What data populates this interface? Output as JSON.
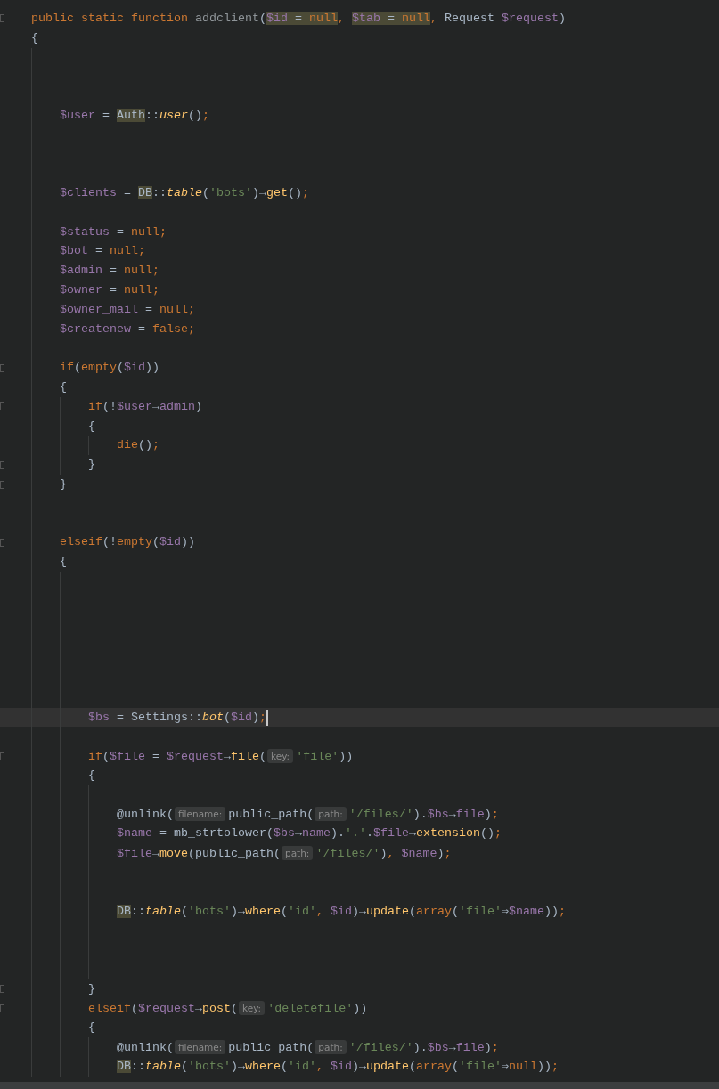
{
  "editor": {
    "lines": [
      {
        "fold_marker": true,
        "current": false,
        "tokens": [
          {
            "text": "public static function ",
            "kind": "kw"
          },
          {
            "text": "addclient",
            "kind": "decl"
          },
          {
            "text": "(",
            "kind": "plain"
          },
          {
            "text": "$id",
            "kind": "var_hl"
          },
          {
            "text": " = ",
            "kind": "plain_hl"
          },
          {
            "text": "null",
            "kind": "kw_hl"
          },
          {
            "text": ", ",
            "kind": "kw"
          },
          {
            "text": "$tab",
            "kind": "var_hl"
          },
          {
            "text": " = ",
            "kind": "plain_hl"
          },
          {
            "text": "null",
            "kind": "kw_hl"
          },
          {
            "text": ", ",
            "kind": "kw"
          },
          {
            "text": "Request ",
            "kind": "plain"
          },
          {
            "text": "$request",
            "kind": "var"
          },
          {
            "text": ")",
            "kind": "plain"
          }
        ]
      },
      {
        "fold_marker": false,
        "current": false,
        "tokens": [
          {
            "text": "{",
            "kind": "plain"
          }
        ],
        "children": [
          {
            "fold_marker": false,
            "current": false
          },
          {
            "fold_marker": false,
            "current": false
          },
          {
            "fold_marker": false,
            "current": false
          },
          {
            "fold_marker": false,
            "current": false,
            "tokens": [
              {
                "text": "$user",
                "kind": "var"
              },
              {
                "text": " = ",
                "kind": "plain"
              },
              {
                "text": "Auth",
                "kind": "class_hl"
              },
              {
                "text": "::",
                "kind": "plain"
              },
              {
                "text": "user",
                "kind": "call"
              },
              {
                "text": "()",
                "kind": "plain"
              },
              {
                "text": ";",
                "kind": "kw"
              }
            ]
          },
          {
            "fold_marker": false,
            "current": false
          },
          {
            "fold_marker": false,
            "current": false
          },
          {
            "fold_marker": false,
            "current": false
          },
          {
            "fold_marker": false,
            "current": false,
            "tokens": [
              {
                "text": "$clients",
                "kind": "var"
              },
              {
                "text": " = ",
                "kind": "plain"
              },
              {
                "text": "DB",
                "kind": "class_hl"
              },
              {
                "text": "::",
                "kind": "plain"
              },
              {
                "text": "table",
                "kind": "call"
              },
              {
                "text": "(",
                "kind": "plain"
              },
              {
                "text": "'bots'",
                "kind": "str"
              },
              {
                "text": ")→",
                "kind": "plain"
              },
              {
                "text": "get",
                "kind": "fn"
              },
              {
                "text": "()",
                "kind": "plain"
              },
              {
                "text": ";",
                "kind": "kw"
              }
            ]
          },
          {
            "fold_marker": false,
            "current": false
          },
          {
            "fold_marker": false,
            "current": false,
            "tokens": [
              {
                "text": "$status",
                "kind": "var"
              },
              {
                "text": " = ",
                "kind": "plain"
              },
              {
                "text": "null;",
                "kind": "kw"
              }
            ]
          },
          {
            "fold_marker": false,
            "current": false,
            "tokens": [
              {
                "text": "$bot",
                "kind": "var"
              },
              {
                "text": " = ",
                "kind": "plain"
              },
              {
                "text": "null;",
                "kind": "kw"
              }
            ]
          },
          {
            "fold_marker": false,
            "current": false,
            "tokens": [
              {
                "text": "$admin",
                "kind": "var"
              },
              {
                "text": " = ",
                "kind": "plain"
              },
              {
                "text": "null;",
                "kind": "kw"
              }
            ]
          },
          {
            "fold_marker": false,
            "current": false,
            "tokens": [
              {
                "text": "$owner",
                "kind": "var"
              },
              {
                "text": " = ",
                "kind": "plain"
              },
              {
                "text": "null;",
                "kind": "kw"
              }
            ]
          },
          {
            "fold_marker": false,
            "current": false,
            "tokens": [
              {
                "text": "$owner_mail",
                "kind": "var"
              },
              {
                "text": " = ",
                "kind": "plain"
              },
              {
                "text": "null;",
                "kind": "kw"
              }
            ]
          },
          {
            "fold_marker": false,
            "current": false,
            "tokens": [
              {
                "text": "$createnew",
                "kind": "var"
              },
              {
                "text": " = ",
                "kind": "plain"
              },
              {
                "text": "false;",
                "kind": "kw"
              }
            ]
          },
          {
            "fold_marker": false,
            "current": false
          },
          {
            "fold_marker": true,
            "current": false,
            "tokens": [
              {
                "text": "if",
                "kind": "kw"
              },
              {
                "text": "(",
                "kind": "plain"
              },
              {
                "text": "empty",
                "kind": "kw"
              },
              {
                "text": "(",
                "kind": "plain"
              },
              {
                "text": "$id",
                "kind": "var"
              },
              {
                "text": "))",
                "kind": "plain"
              }
            ]
          },
          {
            "fold_marker": false,
            "current": false,
            "tokens": [
              {
                "text": "{",
                "kind": "plain"
              }
            ],
            "children": [
              {
                "fold_marker": true,
                "current": false,
                "tokens": [
                  {
                    "text": "if",
                    "kind": "kw"
                  },
                  {
                    "text": "(!",
                    "kind": "plain"
                  },
                  {
                    "text": "$user",
                    "kind": "var"
                  },
                  {
                    "text": "→",
                    "kind": "plain"
                  },
                  {
                    "text": "admin",
                    "kind": "var"
                  },
                  {
                    "text": ")",
                    "kind": "plain"
                  }
                ]
              },
              {
                "fold_marker": false,
                "current": false,
                "tokens": [
                  {
                    "text": "{",
                    "kind": "plain"
                  }
                ],
                "children": [
                  {
                    "fold_marker": false,
                    "current": false,
                    "tokens": [
                      {
                        "text": "die",
                        "kind": "kw"
                      },
                      {
                        "text": "()",
                        "kind": "plain"
                      },
                      {
                        "text": ";",
                        "kind": "kw"
                      }
                    ]
                  }
                ]
              },
              {
                "fold_marker": true,
                "current": false,
                "tokens": [
                  {
                    "text": "}",
                    "kind": "plain"
                  }
                ]
              }
            ]
          },
          {
            "fold_marker": true,
            "current": false,
            "tokens": [
              {
                "text": "}",
                "kind": "plain"
              }
            ]
          },
          {
            "fold_marker": false,
            "current": false
          },
          {
            "fold_marker": false,
            "current": false
          },
          {
            "fold_marker": true,
            "current": false,
            "tokens": [
              {
                "text": "elseif",
                "kind": "kw"
              },
              {
                "text": "(!",
                "kind": "plain"
              },
              {
                "text": "empty",
                "kind": "kw"
              },
              {
                "text": "(",
                "kind": "plain"
              },
              {
                "text": "$id",
                "kind": "var"
              },
              {
                "text": "))",
                "kind": "plain"
              }
            ]
          },
          {
            "fold_marker": false,
            "current": false,
            "tokens": [
              {
                "text": "{",
                "kind": "plain"
              }
            ],
            "children": [
              {
                "fold_marker": false,
                "current": false
              },
              {
                "fold_marker": false,
                "current": false
              },
              {
                "fold_marker": false,
                "current": false
              },
              {
                "fold_marker": false,
                "current": false
              },
              {
                "fold_marker": false,
                "current": false
              },
              {
                "fold_marker": false,
                "current": false
              },
              {
                "fold_marker": false,
                "current": false
              },
              {
                "fold_marker": false,
                "current": true,
                "tokens": [
                  {
                    "text": "$bs",
                    "kind": "var"
                  },
                  {
                    "text": " = Settings::",
                    "kind": "plain"
                  },
                  {
                    "text": "bot",
                    "kind": "call"
                  },
                  {
                    "text": "(",
                    "kind": "plain"
                  },
                  {
                    "text": "$id",
                    "kind": "var"
                  },
                  {
                    "text": ")",
                    "kind": "plain"
                  },
                  {
                    "text": ";",
                    "kind": "kw"
                  }
                ]
              },
              {
                "fold_marker": false,
                "current": false
              },
              {
                "fold_marker": true,
                "current": false,
                "tokens": [
                  {
                    "text": "if",
                    "kind": "kw"
                  },
                  {
                    "text": "(",
                    "kind": "plain"
                  },
                  {
                    "text": "$file",
                    "kind": "var"
                  },
                  {
                    "text": " = ",
                    "kind": "plain"
                  },
                  {
                    "text": "$request",
                    "kind": "var"
                  },
                  {
                    "text": "→",
                    "kind": "plain"
                  },
                  {
                    "text": "file",
                    "kind": "fn"
                  },
                  {
                    "text": "(",
                    "kind": "plain"
                  },
                  {
                    "text": "key:",
                    "kind": "hint"
                  },
                  {
                    "text": "'file'",
                    "kind": "str"
                  },
                  {
                    "text": "))",
                    "kind": "plain"
                  }
                ]
              },
              {
                "fold_marker": false,
                "current": false,
                "tokens": [
                  {
                    "text": "{",
                    "kind": "plain"
                  }
                ],
                "children": [
                  {
                    "fold_marker": false,
                    "current": false
                  },
                  {
                    "fold_marker": false,
                    "current": false,
                    "tokens": [
                      {
                        "text": "@unlink(",
                        "kind": "plain"
                      },
                      {
                        "text": "filename:",
                        "kind": "hint"
                      },
                      {
                        "text": "public_path(",
                        "kind": "plain"
                      },
                      {
                        "text": "path:",
                        "kind": "hint"
                      },
                      {
                        "text": "'/files/'",
                        "kind": "str"
                      },
                      {
                        "text": ").",
                        "kind": "plain"
                      },
                      {
                        "text": "$bs",
                        "kind": "var"
                      },
                      {
                        "text": "→",
                        "kind": "plain"
                      },
                      {
                        "text": "file",
                        "kind": "var"
                      },
                      {
                        "text": ")",
                        "kind": "plain"
                      },
                      {
                        "text": ";",
                        "kind": "kw"
                      }
                    ]
                  },
                  {
                    "fold_marker": false,
                    "current": false,
                    "tokens": [
                      {
                        "text": "$name",
                        "kind": "var"
                      },
                      {
                        "text": " = mb_strtolower(",
                        "kind": "plain"
                      },
                      {
                        "text": "$bs",
                        "kind": "var"
                      },
                      {
                        "text": "→",
                        "kind": "plain"
                      },
                      {
                        "text": "name",
                        "kind": "var"
                      },
                      {
                        "text": ").",
                        "kind": "plain"
                      },
                      {
                        "text": "'.'",
                        "kind": "str"
                      },
                      {
                        "text": ".",
                        "kind": "plain"
                      },
                      {
                        "text": "$file",
                        "kind": "var"
                      },
                      {
                        "text": "→",
                        "kind": "plain"
                      },
                      {
                        "text": "extension",
                        "kind": "fn"
                      },
                      {
                        "text": "()",
                        "kind": "plain"
                      },
                      {
                        "text": ";",
                        "kind": "kw"
                      }
                    ]
                  },
                  {
                    "fold_marker": false,
                    "current": false,
                    "tokens": [
                      {
                        "text": "$file",
                        "kind": "var"
                      },
                      {
                        "text": "→",
                        "kind": "plain"
                      },
                      {
                        "text": "move",
                        "kind": "fn"
                      },
                      {
                        "text": "(public_path(",
                        "kind": "plain"
                      },
                      {
                        "text": "path:",
                        "kind": "hint"
                      },
                      {
                        "text": "'/files/'",
                        "kind": "str"
                      },
                      {
                        "text": ")",
                        "kind": "plain"
                      },
                      {
                        "text": ", ",
                        "kind": "kw"
                      },
                      {
                        "text": "$name",
                        "kind": "var"
                      },
                      {
                        "text": ")",
                        "kind": "plain"
                      },
                      {
                        "text": ";",
                        "kind": "kw"
                      }
                    ]
                  },
                  {
                    "fold_marker": false,
                    "current": false
                  },
                  {
                    "fold_marker": false,
                    "current": false
                  },
                  {
                    "fold_marker": false,
                    "current": false,
                    "tokens": [
                      {
                        "text": "DB",
                        "kind": "class_hl"
                      },
                      {
                        "text": "::",
                        "kind": "plain"
                      },
                      {
                        "text": "table",
                        "kind": "call"
                      },
                      {
                        "text": "(",
                        "kind": "plain"
                      },
                      {
                        "text": "'bots'",
                        "kind": "str"
                      },
                      {
                        "text": ")→",
                        "kind": "plain"
                      },
                      {
                        "text": "where",
                        "kind": "fn"
                      },
                      {
                        "text": "(",
                        "kind": "plain"
                      },
                      {
                        "text": "'id'",
                        "kind": "str"
                      },
                      {
                        "text": ", ",
                        "kind": "kw"
                      },
                      {
                        "text": "$id",
                        "kind": "var"
                      },
                      {
                        "text": ")→",
                        "kind": "plain"
                      },
                      {
                        "text": "update",
                        "kind": "fn"
                      },
                      {
                        "text": "(",
                        "kind": "plain"
                      },
                      {
                        "text": "array",
                        "kind": "kw"
                      },
                      {
                        "text": "(",
                        "kind": "plain"
                      },
                      {
                        "text": "'file'",
                        "kind": "str"
                      },
                      {
                        "text": "⇒",
                        "kind": "plain"
                      },
                      {
                        "text": "$name",
                        "kind": "var"
                      },
                      {
                        "text": "))",
                        "kind": "plain"
                      },
                      {
                        "text": ";",
                        "kind": "kw"
                      }
                    ]
                  },
                  {
                    "fold_marker": false,
                    "current": false
                  },
                  {
                    "fold_marker": false,
                    "current": false
                  },
                  {
                    "fold_marker": false,
                    "current": false
                  }
                ]
              },
              {
                "fold_marker": true,
                "current": false,
                "tokens": [
                  {
                    "text": "}",
                    "kind": "plain"
                  }
                ]
              },
              {
                "fold_marker": true,
                "current": false,
                "tokens": [
                  {
                    "text": "elseif",
                    "kind": "kw"
                  },
                  {
                    "text": "(",
                    "kind": "plain"
                  },
                  {
                    "text": "$request",
                    "kind": "var"
                  },
                  {
                    "text": "→",
                    "kind": "plain"
                  },
                  {
                    "text": "post",
                    "kind": "fn"
                  },
                  {
                    "text": "(",
                    "kind": "plain"
                  },
                  {
                    "text": "key:",
                    "kind": "hint"
                  },
                  {
                    "text": "'deletefile'",
                    "kind": "str"
                  },
                  {
                    "text": "))",
                    "kind": "plain"
                  }
                ]
              },
              {
                "fold_marker": false,
                "current": false,
                "tokens": [
                  {
                    "text": "{",
                    "kind": "plain"
                  }
                ],
                "children": [
                  {
                    "fold_marker": false,
                    "current": false,
                    "tokens": [
                      {
                        "text": "@unlink(",
                        "kind": "plain"
                      },
                      {
                        "text": "filename:",
                        "kind": "hint"
                      },
                      {
                        "text": "public_path(",
                        "kind": "plain"
                      },
                      {
                        "text": "path:",
                        "kind": "hint"
                      },
                      {
                        "text": "'/files/'",
                        "kind": "str"
                      },
                      {
                        "text": ").",
                        "kind": "plain"
                      },
                      {
                        "text": "$bs",
                        "kind": "var"
                      },
                      {
                        "text": "→",
                        "kind": "plain"
                      },
                      {
                        "text": "file",
                        "kind": "var"
                      },
                      {
                        "text": ")",
                        "kind": "plain"
                      },
                      {
                        "text": ";",
                        "kind": "kw"
                      }
                    ]
                  },
                  {
                    "fold_marker": false,
                    "current": false,
                    "tokens": [
                      {
                        "text": "DB",
                        "kind": "class_hl"
                      },
                      {
                        "text": "::",
                        "kind": "plain"
                      },
                      {
                        "text": "table",
                        "kind": "call"
                      },
                      {
                        "text": "(",
                        "kind": "plain"
                      },
                      {
                        "text": "'bots'",
                        "kind": "str"
                      },
                      {
                        "text": ")→",
                        "kind": "plain"
                      },
                      {
                        "text": "where",
                        "kind": "fn"
                      },
                      {
                        "text": "(",
                        "kind": "plain"
                      },
                      {
                        "text": "'id'",
                        "kind": "str"
                      },
                      {
                        "text": ", ",
                        "kind": "kw"
                      },
                      {
                        "text": "$id",
                        "kind": "var"
                      },
                      {
                        "text": ")→",
                        "kind": "plain"
                      },
                      {
                        "text": "update",
                        "kind": "fn"
                      },
                      {
                        "text": "(",
                        "kind": "plain"
                      },
                      {
                        "text": "array",
                        "kind": "kw"
                      },
                      {
                        "text": "(",
                        "kind": "plain"
                      },
                      {
                        "text": "'file'",
                        "kind": "str"
                      },
                      {
                        "text": "⇒",
                        "kind": "plain"
                      },
                      {
                        "text": "null",
                        "kind": "kw"
                      },
                      {
                        "text": "))",
                        "kind": "plain"
                      },
                      {
                        "text": ";",
                        "kind": "kw"
                      }
                    ]
                  }
                ]
              }
            ]
          }
        ]
      }
    ]
  }
}
